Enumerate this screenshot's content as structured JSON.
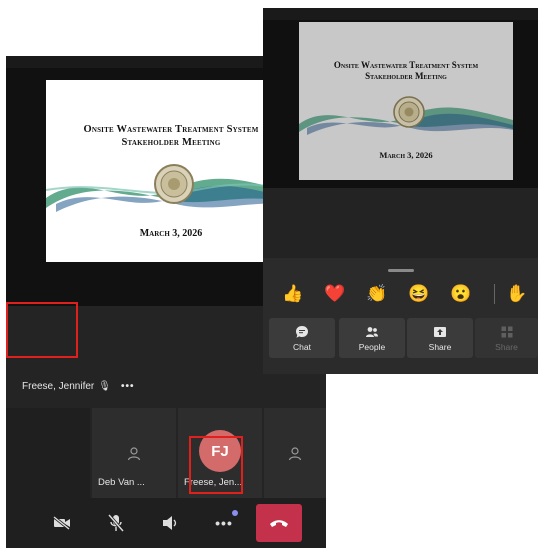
{
  "back_screen": {
    "slide": {
      "title_line1": "Onsite Wastewater Treatment System",
      "title_line2": "Stakeholder Meeting",
      "date": "March 3, 2026"
    },
    "presenter": {
      "name": "Freese, Jennifer",
      "more_label": "•••"
    },
    "tiles": [
      {
        "name": ""
      },
      {
        "name": "Deb Van ..."
      },
      {
        "name": "Freese, Jen...",
        "initials": "FJ"
      },
      {
        "name": ""
      }
    ],
    "controls": {
      "more_label": "•••"
    }
  },
  "front_screen": {
    "slide": {
      "title_line1": "Onsite Wastewater Treatment System",
      "title_line2": "Stakeholder Meeting",
      "date": "March 3, 2026"
    },
    "reactions": [
      "👍",
      "❤️",
      "👏",
      "😆",
      "😮",
      "✋"
    ],
    "actions": [
      {
        "label": "Chat",
        "icon": "chat-icon"
      },
      {
        "label": "People",
        "icon": "people-icon"
      },
      {
        "label": "Share",
        "icon": "share-icon"
      },
      {
        "label": "Share",
        "icon": "grid-icon"
      }
    ]
  },
  "colors": {
    "hangup": "#c4314b",
    "highlight": "#e0201c",
    "avatar": "#d36b6b",
    "notify_dot": "#8a8ef0"
  }
}
